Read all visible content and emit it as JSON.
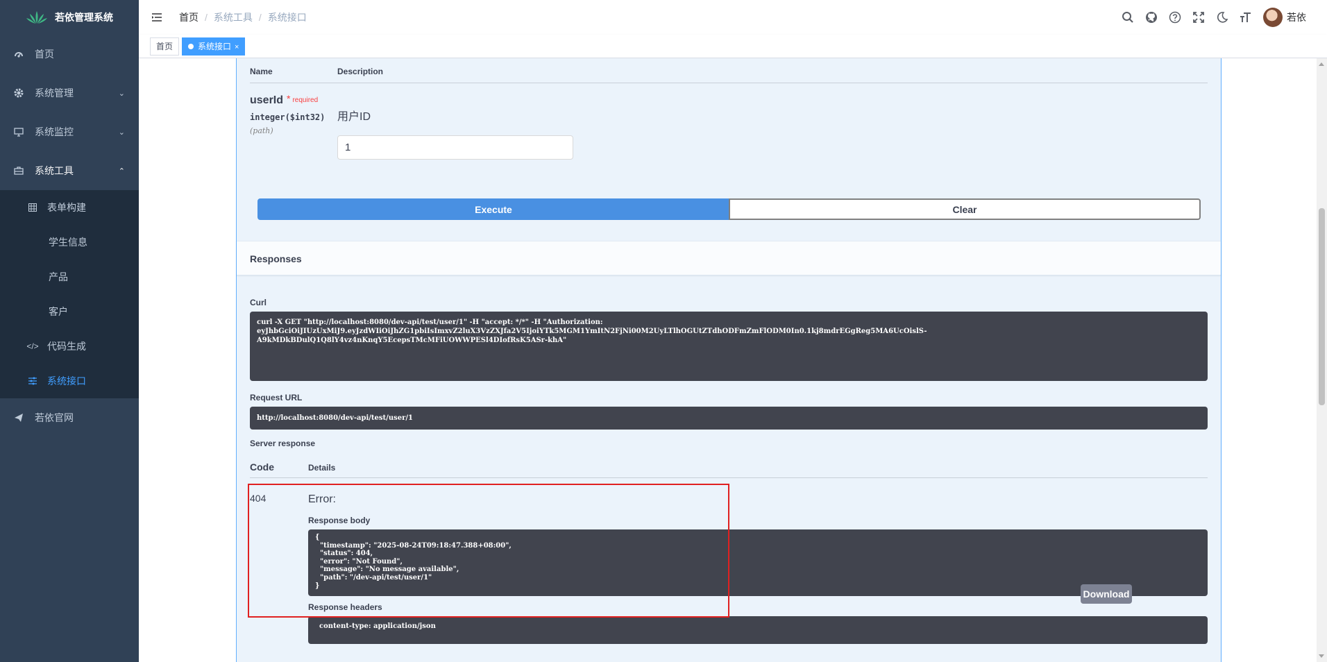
{
  "sidebar": {
    "title": "若依管理系统",
    "items": [
      {
        "label": "首页",
        "icon": "dashboard-icon"
      },
      {
        "label": "系统管理",
        "icon": "gear-icon"
      },
      {
        "label": "系统监控",
        "icon": "monitor-icon"
      },
      {
        "label": "系统工具",
        "icon": "toolbox-icon"
      },
      {
        "label": "若依官网",
        "icon": "send-icon"
      }
    ],
    "sub_items": [
      {
        "label": "表单构建",
        "icon": "table-icon"
      },
      {
        "label": "学生信息"
      },
      {
        "label": "产品"
      },
      {
        "label": "客户"
      },
      {
        "label": "代码生成",
        "icon": "code-icon"
      },
      {
        "label": "系统接口",
        "icon": "sliders-icon",
        "active": true
      }
    ]
  },
  "navbar": {
    "breadcrumb": [
      "首页",
      "系统工具",
      "系统接口"
    ],
    "username": "若依",
    "icons": [
      "search-icon",
      "github-icon",
      "help-icon",
      "fullscreen-icon",
      "moon-icon",
      "font-size-icon"
    ]
  },
  "tags": {
    "home": "首页",
    "active": "系统接口",
    "close": "×"
  },
  "colors": {
    "sidebar_bg": "#304156",
    "submenu_bg": "#1f2d3d",
    "accent": "#409eff",
    "execute": "#4990e2",
    "code_bg": "#41444e",
    "highlight": "#e02020"
  },
  "swagger": {
    "params_header": {
      "name": "Name",
      "description": "Description"
    },
    "param": {
      "name": "userId",
      "required_mark": "*",
      "required": "required",
      "type": "integer($int32)",
      "in": "(path)",
      "description": "用户ID",
      "value": "1"
    },
    "execute": "Execute",
    "clear": "Clear",
    "responses_title": "Responses",
    "curl_label": "Curl",
    "curl": "curl -X GET \"http://localhost:8080/dev-api/test/user/1\" -H \"accept: */*\" -H \"Authorization:\neyJhbGciOiJIUzUxMiJ9.eyJzdWIiOiJhZG1pbiIsImxvZ2luX3VzZXJfa2V5IjoiYTk5MGM1YmItN2FjNi00M2UyLTlhOGUtZTdhODFmZmFlODM0In0.1kj8mdrEGgReg5MA6UcOislS-\nA9kMDkBDulQ1Q8lY4vz4nKnqY5EcepsTMcMFiUOWWPESl4DIofRsK5ASr-khA\"",
    "request_url_label": "Request URL",
    "request_url": "http://localhost:8080/dev-api/test/user/1",
    "server_response_label": "Server response",
    "code_header": "Code",
    "details_header": "Details",
    "response_code": "404",
    "error_title": "Error:",
    "response_body_label": "Response body",
    "response_body": "{\n  \"timestamp\": \"2025-08-24T09:18:47.388+08:00\",\n  \"status\": 404,\n  \"error\": \"Not Found\",\n  \"message\": \"No message available\",\n  \"path\": \"/dev-api/test/user/1\"\n}",
    "download": "Download",
    "response_headers_label": "Response headers",
    "response_headers": "content-type: application/json"
  }
}
